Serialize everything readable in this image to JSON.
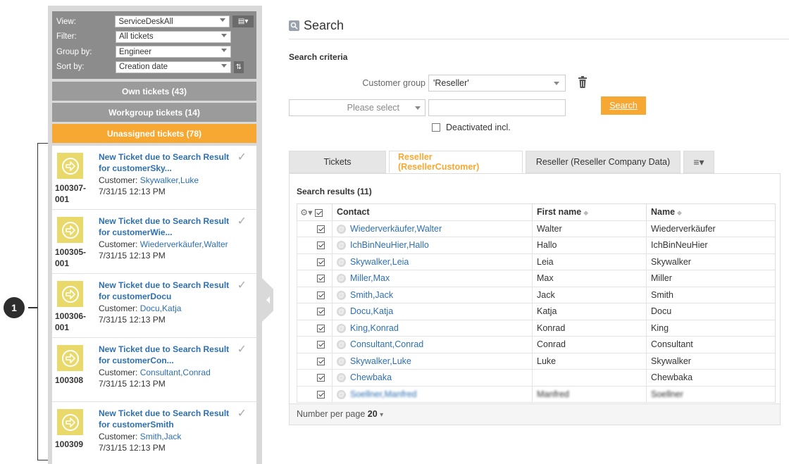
{
  "callout": {
    "number": "1"
  },
  "filters": {
    "view": {
      "label": "View:",
      "value": "ServiceDeskAll"
    },
    "filter": {
      "label": "Filter:",
      "value": "All tickets"
    },
    "group_by": {
      "label": "Group by:",
      "value": "Engineer"
    },
    "sort_by": {
      "label": "Sort by:",
      "value": "Creation date"
    }
  },
  "ticket_buttons": {
    "own": "Own tickets (43)",
    "workgroup": "Workgroup tickets (14)",
    "unassigned": "Unassigned tickets (78)"
  },
  "tickets": [
    {
      "number": "100307-001",
      "title": "New Ticket due to Search Result for customerSky...",
      "customer_label": "Customer:",
      "customer": "Skywalker,Luke",
      "date": "7/31/15 12:13 PM"
    },
    {
      "number": "100305-001",
      "title": "New Ticket due to Search Result for customerWie...",
      "customer_label": "Customer:",
      "customer": "Wiederverkäufer,Walter",
      "date": "7/31/15 12:13 PM"
    },
    {
      "number": "100306-001",
      "title": "New Ticket due to Search Result for customerDocu",
      "customer_label": "Customer:",
      "customer": "Docu,Katja",
      "date": "7/31/15 12:13 PM"
    },
    {
      "number": "100308",
      "title": "New Ticket due to Search Result for customerCon...",
      "customer_label": "Customer:",
      "customer": "Consultant,Conrad",
      "date": "7/31/15 12:13 PM"
    },
    {
      "number": "100309",
      "title": "New Ticket due to Search Result for customerSmith",
      "customer_label": "Customer:",
      "customer": "Smith,Jack",
      "date": "7/31/15 12:13 PM"
    }
  ],
  "search": {
    "title": "Search",
    "criteria_label": "Search criteria",
    "customer_group_label": "Customer group",
    "customer_group_value": "'Reseller'",
    "please_select": "Please select",
    "search_button": "Search",
    "deactivated_label": "Deactivated incl."
  },
  "tabs": [
    "Tickets",
    "Reseller (ResellerCustomer)",
    "Reseller (Reseller Company Data)"
  ],
  "results": {
    "label": "Search results (11)",
    "columns": [
      "Contact",
      "First name",
      "Name"
    ],
    "rows": [
      {
        "contact": "Wiederverkäufer,Walter",
        "first": "Walter",
        "name": "Wiederverkäufer"
      },
      {
        "contact": "IchBinNeuHier,Hallo",
        "first": "Hallo",
        "name": "IchBinNeuHier"
      },
      {
        "contact": "Skywalker,Leia",
        "first": "Leia",
        "name": "Skywalker"
      },
      {
        "contact": "Miller,Max",
        "first": "Max",
        "name": "Miller"
      },
      {
        "contact": "Smith,Jack",
        "first": "Jack",
        "name": "Smith"
      },
      {
        "contact": "Docu,Katja",
        "first": "Katja",
        "name": "Docu"
      },
      {
        "contact": "King,Konrad",
        "first": "Konrad",
        "name": "King"
      },
      {
        "contact": "Consultant,Conrad",
        "first": "Conrad",
        "name": "Consultant"
      },
      {
        "contact": "Skywalker,Luke",
        "first": "Luke",
        "name": "Skywalker"
      },
      {
        "contact": "Chewbaka",
        "first": "",
        "name": "Chewbaka"
      },
      {
        "contact": "Soellner,Manfred",
        "first": "Manfred",
        "name": "Soellner"
      }
    ],
    "per_page_label": "Number per page",
    "per_page_value": "20"
  },
  "colors": {
    "accent": "#f7a833",
    "link": "#2e6fb0",
    "panel": "#d9d9d9",
    "ticket_icon": "#e8d96a"
  },
  "icons": {
    "ticket": "arrow-circle-icon",
    "check": "check-icon",
    "trash": "trash-icon",
    "search": "search-icon",
    "settings": "gear-icon",
    "contact": "at-icon",
    "menu": "list-menu-icon"
  }
}
